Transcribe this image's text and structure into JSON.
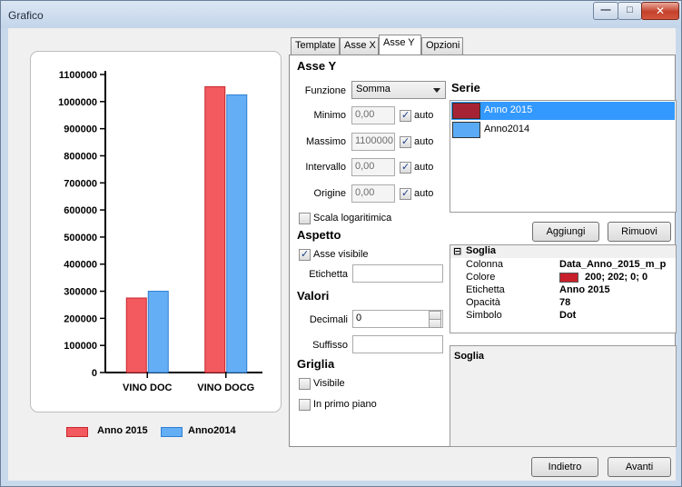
{
  "window": {
    "title": "Grafico"
  },
  "tabs": [
    "Template",
    "Asse X",
    "Asse Y",
    "Opzioni"
  ],
  "asse_y": {
    "heading": "Asse Y",
    "funzione_label": "Funzione",
    "funzione_value": "Somma",
    "minimo_label": "Minimo",
    "minimo_value": "0,00",
    "massimo_label": "Massimo",
    "massimo_value": "1100000",
    "intervallo_label": "Intervallo",
    "intervallo_value": "0,00",
    "origine_label": "Origine",
    "origine_value": "0,00",
    "auto_label": "auto",
    "scala_log_label": "Scala logaritimica"
  },
  "aspetto": {
    "heading": "Aspetto",
    "asse_visibile_label": "Asse visibile",
    "etichetta_label": "Etichetta",
    "etichetta_value": ""
  },
  "valori": {
    "heading": "Valori",
    "decimali_label": "Decimali",
    "decimali_value": "0",
    "suffisso_label": "Suffisso",
    "suffisso_value": ""
  },
  "griglia": {
    "heading": "Griglia",
    "visibile_label": "Visibile",
    "primo_piano_label": "In primo piano"
  },
  "serie": {
    "heading": "Serie",
    "items": [
      {
        "label": "Anno 2015",
        "color": "#a52335"
      },
      {
        "label": "Anno2014",
        "color": "#5aaaf6"
      }
    ],
    "aggiungi_label": "Aggiungi",
    "rimuovi_label": "Rimuovi"
  },
  "soglia": {
    "heading": "Soglia",
    "colonna_label": "Colonna",
    "colonna_value": "Data_Anno_2015_m_p",
    "colore_label": "Colore",
    "colore_value": "200; 202; 0; 0",
    "colore_swatch": "#c8202a",
    "etichetta_label": "Etichetta",
    "etichetta_value": "Anno 2015",
    "opacita_label": "Opacità",
    "opacita_value": "78",
    "simbolo_label": "Simbolo",
    "simbolo_value": "Dot",
    "desc_title": "Soglia"
  },
  "buttons": {
    "indietro": "Indietro",
    "avanti": "Avanti"
  },
  "chart_data": {
    "type": "bar",
    "categories": [
      "VINO DOC",
      "VINO DOCG"
    ],
    "series": [
      {
        "name": "Anno 2015",
        "values": [
          275000,
          1055000
        ],
        "color": "#f25a5f"
      },
      {
        "name": "Anno2014",
        "values": [
          300000,
          1025000
        ],
        "color": "#63aef5"
      }
    ],
    "ylim": [
      0,
      1100000
    ],
    "yticks": [
      "0",
      "100000",
      "200000",
      "300000",
      "400000",
      "500000",
      "600000",
      "700000",
      "800000",
      "900000",
      "1000000",
      "1100000"
    ],
    "grid": false,
    "legend": "bottom"
  }
}
